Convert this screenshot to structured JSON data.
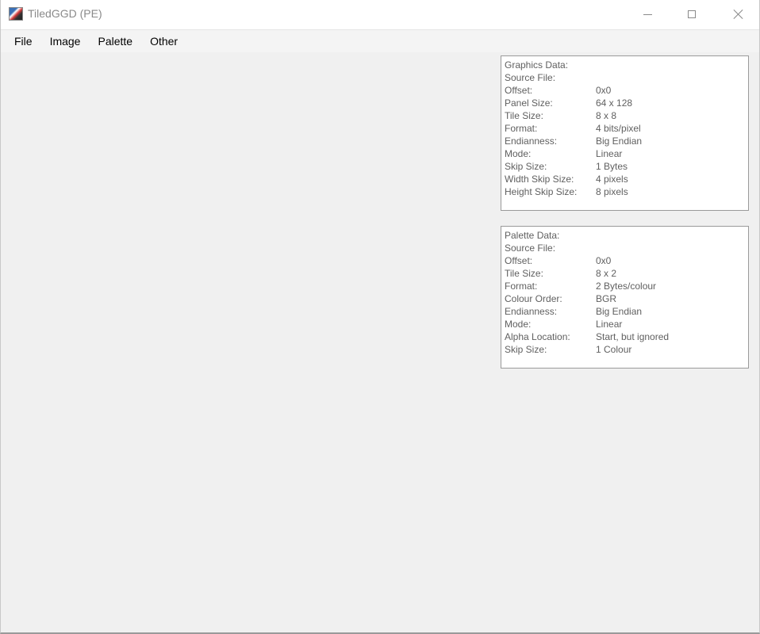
{
  "window": {
    "title": "TiledGGD (PE)",
    "icon": "app-icon",
    "controls": {
      "minimize": "minimize-icon",
      "maximize": "maximize-icon",
      "close": "close-icon"
    }
  },
  "menu": {
    "items": [
      {
        "label": "File"
      },
      {
        "label": "Image"
      },
      {
        "label": "Palette"
      },
      {
        "label": "Other"
      }
    ]
  },
  "graphics": {
    "heading": "Graphics Data:",
    "rows": [
      {
        "key": "Source File:",
        "value": ""
      },
      {
        "key": "Offset:",
        "value": "0x0"
      },
      {
        "key": "Panel Size:",
        "value": "64 x 128"
      },
      {
        "key": "Tile Size:",
        "value": "8 x 8"
      },
      {
        "key": "Format:",
        "value": "4 bits/pixel"
      },
      {
        "key": "Endianness:",
        "value": "Big Endian"
      },
      {
        "key": "Mode:",
        "value": "Linear"
      },
      {
        "key": "Skip Size:",
        "value": "1 Bytes"
      },
      {
        "key": "Width Skip Size:",
        "value": "4 pixels"
      },
      {
        "key": "Height Skip Size:",
        "value": "8 pixels"
      }
    ]
  },
  "palette": {
    "heading": "Palette Data:",
    "rows": [
      {
        "key": "Source File:",
        "value": ""
      },
      {
        "key": "Offset:",
        "value": "0x0"
      },
      {
        "key": "Tile Size:",
        "value": "8 x 2"
      },
      {
        "key": "Format:",
        "value": "2 Bytes/colour"
      },
      {
        "key": "Colour Order:",
        "value": "BGR"
      },
      {
        "key": "Endianness:",
        "value": "Big Endian"
      },
      {
        "key": "Mode:",
        "value": "Linear"
      },
      {
        "key": "Alpha Location:",
        "value": "Start, but ignored"
      },
      {
        "key": "Skip Size:",
        "value": "1 Colour"
      }
    ]
  }
}
